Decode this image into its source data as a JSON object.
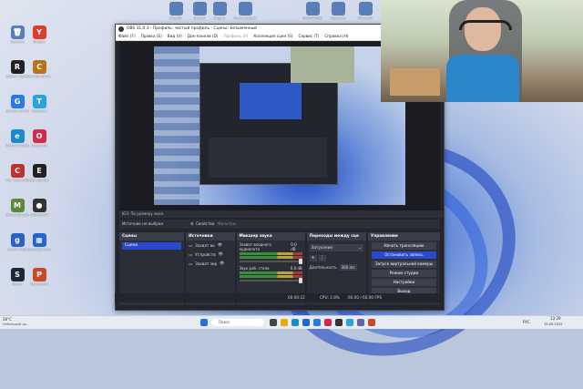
{
  "desktop_icons": [
    {
      "label": "Корзина",
      "color": "#5a7fb8",
      "glyph": "🗑"
    },
    {
      "label": "Roblox Player",
      "color": "#222",
      "glyph": "R"
    },
    {
      "label": "Google Chrome",
      "color": "#2a7ae2",
      "glyph": "G"
    },
    {
      "label": "Microsoft Edge",
      "color": "#1b8ac9",
      "glyph": "e"
    },
    {
      "label": "The Crew Motorfest",
      "color": "#c03030",
      "glyph": "C"
    },
    {
      "label": "Minecraft Launcher",
      "color": "#5c8a3a",
      "glyph": "M"
    },
    {
      "label": "Garry's Mod",
      "color": "#2b63c4",
      "glyph": "g"
    },
    {
      "label": "Steam",
      "color": "#1b2838",
      "glyph": "S"
    },
    {
      "label": "Яндекс",
      "color": "#e03c2b",
      "glyph": "Y"
    },
    {
      "label": "Counter-Strike 2",
      "color": "#b8741a",
      "glyph": "C"
    },
    {
      "label": "Telegram",
      "color": "#2aa3dc",
      "glyph": "T"
    },
    {
      "label": "Opera GX",
      "color": "#d12c4a",
      "glyph": "O"
    },
    {
      "label": "Epic Games",
      "color": "#222",
      "glyph": "E"
    },
    {
      "label": "OBS Studio",
      "color": "#333",
      "glyph": "●"
    },
    {
      "label": "Microsoft Store",
      "color": "#2266cc",
      "glyph": "▦"
    },
    {
      "label": "PowerPoint",
      "color": "#c9482b",
      "glyph": "P"
    }
  ],
  "desktop_top_labels": [
    "Skriptin",
    "Discord",
    "Stoppe",
    "ExtremeInject",
    "0000000ВК",
    "Проекты",
    "Microsoft"
  ],
  "obs": {
    "title": "OBS 31.0.3 - Профиль: чистый профиль - Сцены: Безымянный",
    "menu": [
      "Файл (F)",
      "Правка (E)",
      "Вид (V)",
      "Док-панели (D)",
      "Профиль (P)",
      "Коллекция сцен (S)",
      "Сервис (T)",
      "Справка (H)"
    ],
    "preview_bar": "ЮЗ: По размеру окна",
    "source_not_selected": "Источник не выбран",
    "properties": "Свойства",
    "filters": "Фильтры",
    "scenes": {
      "header": "Сцены",
      "items": [
        "Сцена"
      ]
    },
    "sources": {
      "header": "Источники",
      "items": [
        "Захват во",
        "Устройств",
        "Захват экр"
      ]
    },
    "mixer": {
      "header": "Микшер звука",
      "channels": [
        {
          "name": "Захват входного аудиопото",
          "db": "0.0 dB"
        },
        {
          "name": "Звук раб. стола",
          "db": "0.0 dB"
        }
      ]
    },
    "transitions": {
      "header": "Переходы между сце",
      "type": "Затухание",
      "duration_label": "Длительность",
      "duration_value": "300 ms"
    },
    "controls": {
      "header": "Управление",
      "buttons": [
        "Начать трансляцию",
        "Остановить запись",
        "Запуск виртуальной камеры",
        "Режим студии",
        "Настройки",
        "Выход"
      ]
    },
    "status": {
      "rec": "00:00:22",
      "cpu": "CPU: 2.8%",
      "fps": "60.00 / 60.00 FPS",
      "live": "00:00:00"
    }
  },
  "taskbar": {
    "weather_temp": "28°C",
    "weather_desc": "Небольшой до...",
    "search_placeholder": "Поиск",
    "lang": "РУС",
    "time": "13:29",
    "date": "19.05.2025"
  }
}
